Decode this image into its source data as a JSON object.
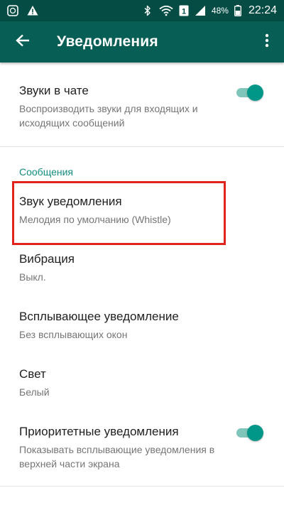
{
  "status_bar": {
    "battery": "48%",
    "time": "22:24",
    "sim_badge": "1",
    "icons": [
      "whatsapp-icon",
      "alert-icon",
      "bluetooth-icon",
      "wifi-icon",
      "sim-icon",
      "signal-icon",
      "battery-icon"
    ]
  },
  "app_bar": {
    "title": "Уведомления",
    "icons": [
      "back-arrow-icon",
      "more-vert-icon"
    ]
  },
  "settings": {
    "chat_sounds": {
      "title": "Звуки в чате",
      "subtitle": "Воспроизводить звуки для входящих и исходящих сообщений",
      "enabled": true
    },
    "messages_header": "Сообщения",
    "notification_sound": {
      "title": "Звук уведомления",
      "subtitle": "Мелодия по умолчанию (Whistle)"
    },
    "vibration": {
      "title": "Вибрация",
      "subtitle": "Выкл."
    },
    "popup": {
      "title": "Всплывающее уведомление",
      "subtitle": "Без всплывающих окон"
    },
    "light": {
      "title": "Свет",
      "subtitle": "Белый"
    },
    "priority": {
      "title": "Приоритетные уведомления",
      "subtitle": "Показывать всплывающие уведомления в верхней части экрана",
      "enabled": true
    }
  },
  "colors": {
    "status_bar": "#054d44",
    "app_bar": "#075e54",
    "accent": "#009688",
    "section_header": "#128c7e",
    "highlight": "#e0231b"
  }
}
